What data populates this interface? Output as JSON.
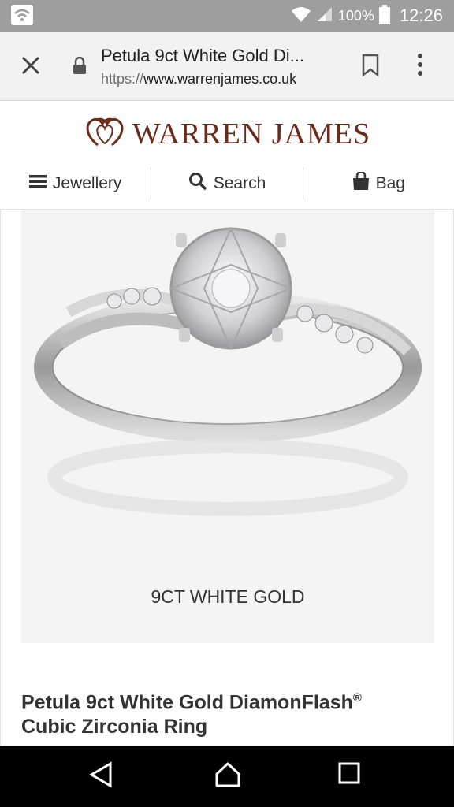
{
  "status_bar": {
    "battery": "100%",
    "time": "12:26"
  },
  "browser": {
    "page_title": "Petula 9ct White Gold Di...",
    "url_scheme": "https://",
    "url_host": "www.warrenjames.co.uk"
  },
  "site": {
    "logo_text": "WARREN JAMES",
    "nav": {
      "jewellery": "Jewellery",
      "search": "Search",
      "bag": "Bag"
    }
  },
  "product": {
    "image_caption": "9CT WHITE GOLD",
    "name_line1": "Petula 9ct White Gold DiamonFlash",
    "name_mark": "®",
    "name_line2": "Cubic Zirconia Ring"
  },
  "icons": [
    "wifi-icon",
    "signal-icon",
    "battery-icon",
    "close-icon",
    "lock-icon",
    "bookmark-icon",
    "more-icon",
    "menu-icon",
    "search-icon",
    "bag-icon",
    "back-icon",
    "home-icon",
    "recents-icon"
  ],
  "colors": {
    "status_bar": "#9e9e9e",
    "brand": "#6b2b1a",
    "toolbar": "#f2f2f2"
  }
}
